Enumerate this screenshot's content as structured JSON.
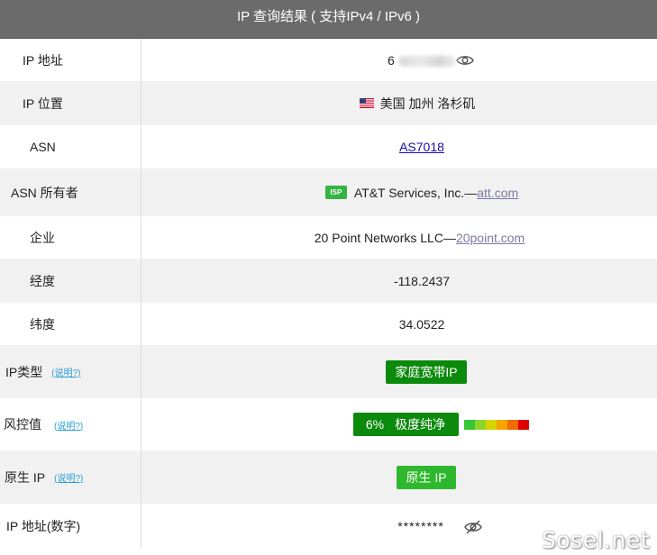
{
  "header": {
    "title": "IP 查询结果 ( 支持IPv4 / IPv6 )"
  },
  "rows": {
    "ip": {
      "label": "IP 地址",
      "value_visible": "6"
    },
    "location": {
      "label": "IP 位置",
      "value": "美国 加州 洛杉矶"
    },
    "asn": {
      "label": "ASN",
      "value": "AS7018"
    },
    "asn_owner": {
      "label": "ASN 所有者",
      "badge": "ISP",
      "value": "AT&T Services, Inc.—",
      "link": "att.com"
    },
    "company": {
      "label": "企业",
      "value": "20 Point Networks LLC—",
      "link": "20point.com"
    },
    "longitude": {
      "label": "经度",
      "value": "-118.2437"
    },
    "latitude": {
      "label": "纬度",
      "value": "34.0522"
    },
    "ip_type": {
      "label": "IP类型",
      "help": "(说明?)",
      "value": "家庭宽带IP"
    },
    "risk": {
      "label": "风控值",
      "help": "(说明?)",
      "percent": "6%",
      "value": "极度纯净"
    },
    "native_ip": {
      "label": "原生 IP",
      "help": "(说明?)",
      "value": "原生 IP"
    },
    "ip_numeric": {
      "label": "IP 地址(数字)",
      "value": "********"
    }
  },
  "colors": {
    "header_bg": "#6b6b6b",
    "green_dark": "#0b8a0b",
    "green_light": "#2db82d",
    "risk_scale": [
      "#35c735",
      "#8fd42a",
      "#d6d400",
      "#f7a400",
      "#f06a00",
      "#e00000"
    ]
  },
  "icons": {
    "eye": "eye-icon",
    "eye_hidden": "eye-slash-icon",
    "flag": "us-flag-icon"
  },
  "watermark": "Sosel.net"
}
